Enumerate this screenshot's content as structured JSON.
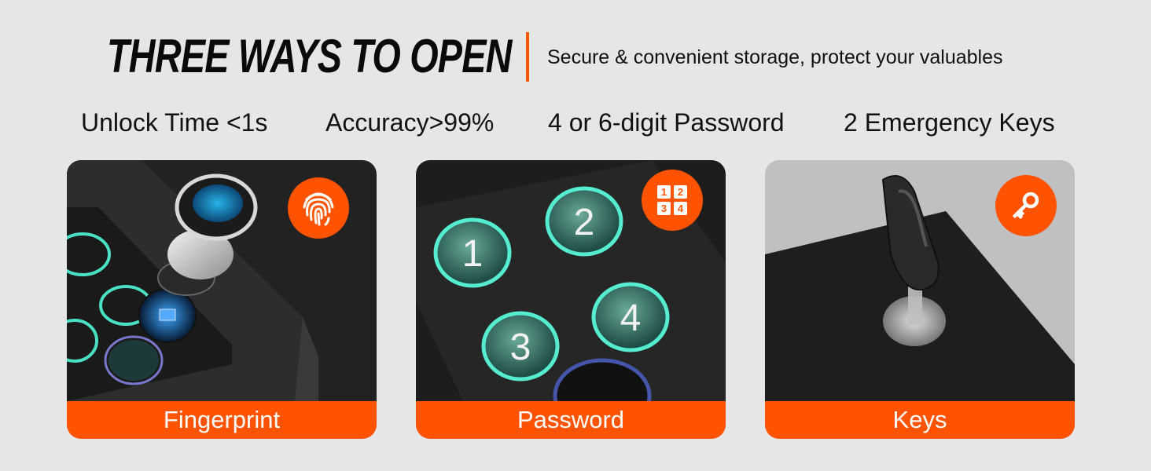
{
  "header": {
    "title": "THREE WAYS TO OPEN",
    "subtitle": "Secure & convenient storage, protect your valuables"
  },
  "features": [
    "Unlock Time <1s",
    "Accuracy>99%",
    "4 or 6-digit Password",
    "2 Emergency Keys"
  ],
  "cards": [
    {
      "label": "Fingerprint",
      "icon": "fingerprint-icon"
    },
    {
      "label": "Password",
      "icon": "keypad-icon",
      "keypad_digits": [
        "1",
        "2",
        "3",
        "4"
      ]
    },
    {
      "label": "Keys",
      "icon": "key-icon"
    }
  ],
  "colors": {
    "accent": "#ff5300",
    "background": "#e6e6e6",
    "glow": "#49e0c4"
  }
}
